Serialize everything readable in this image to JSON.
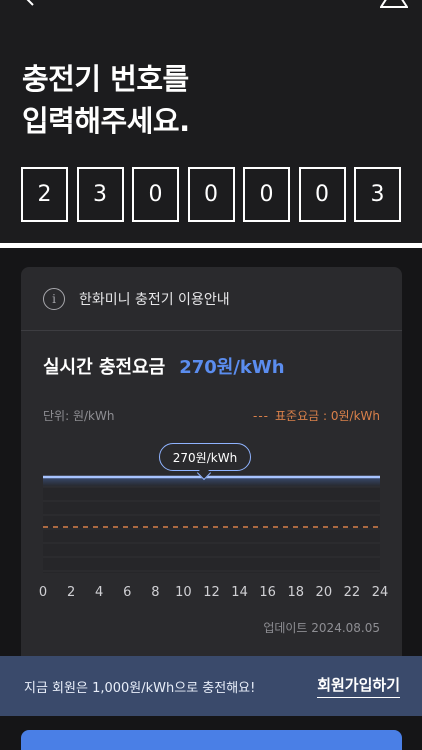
{
  "header": {
    "back_icon": "chevron-left-icon",
    "warn_icon": "warning-triangle-icon",
    "title_line1": "충전기 번호를",
    "title_line2": "입력해주세요."
  },
  "charger_number": {
    "digits": [
      "2",
      "3",
      "0",
      "0",
      "0",
      "0",
      "3"
    ]
  },
  "info_card": {
    "info_icon_glyph": "i",
    "info_text": "한화미니 충전기 이용안내",
    "price_label": "실시간 충전요금",
    "price_value": "270원/kWh",
    "unit_label": "단위: 원/kWh",
    "legend_dash": "---",
    "legend_text": "표준요금 : 0원/kWh",
    "tooltip": "270원/kWh",
    "update_text": "업데이트 2024.08.05"
  },
  "chart_data": {
    "type": "line",
    "x": [
      0,
      2,
      4,
      6,
      8,
      10,
      12,
      14,
      16,
      18,
      20,
      22,
      24
    ],
    "series": [
      {
        "values": [
          270,
          270,
          270,
          270,
          270,
          270,
          270,
          270,
          270,
          270,
          270,
          270,
          270
        ]
      }
    ],
    "standard_rate": 0,
    "tick_labels": [
      "0",
      "2",
      "4",
      "6",
      "8",
      "10",
      "12",
      "14",
      "16",
      "18",
      "20",
      "22",
      "24"
    ],
    "xlim": [
      0,
      24
    ],
    "colors": {
      "line": "#a8c4ff",
      "standard": "#d9804a"
    }
  },
  "banner": {
    "text": "지금 회원은 1,000원/kWh으로 충전해요!",
    "link": "회원가입하기"
  },
  "colors": {
    "accent": "#5b8def",
    "background": "#1c1c1e",
    "card": "#2a2a2d",
    "banner": "#3a4a6b"
  }
}
